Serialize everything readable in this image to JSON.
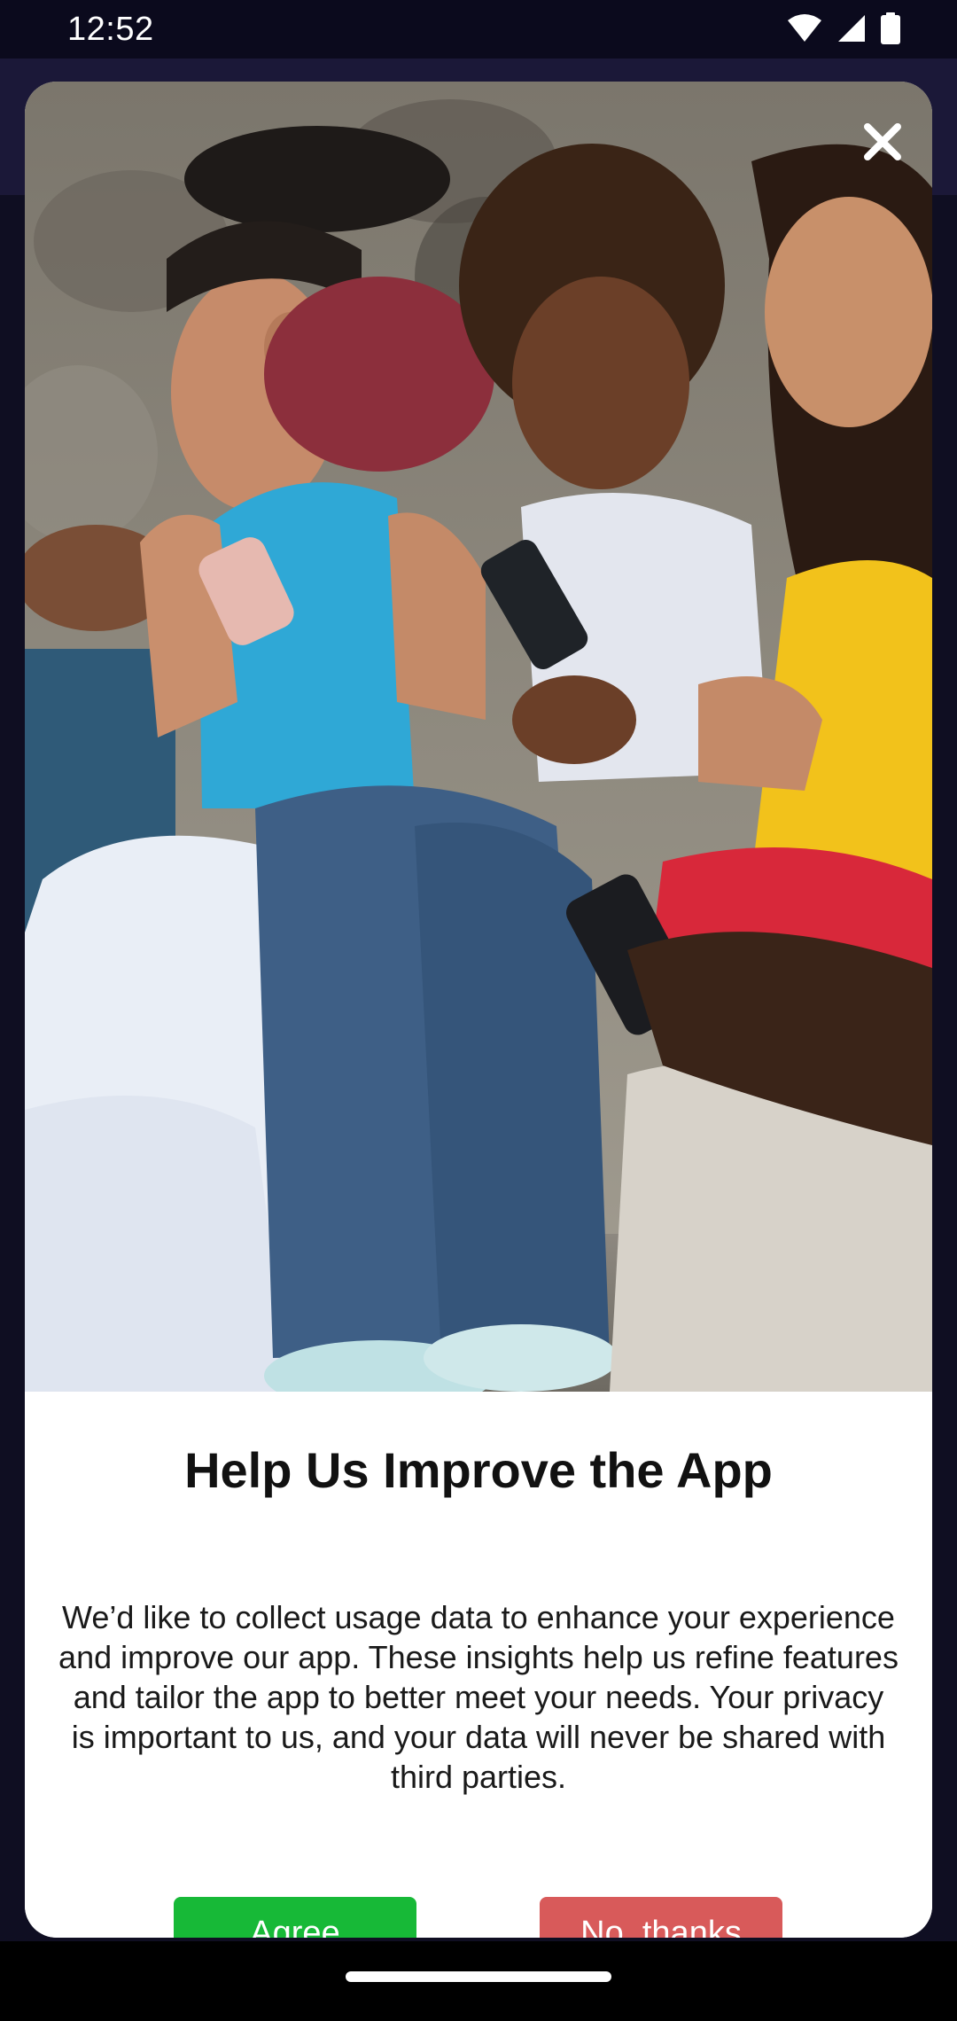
{
  "status_bar": {
    "time": "12:52",
    "icons": [
      "wifi-icon",
      "cellular-signal-icon",
      "battery-icon"
    ]
  },
  "dialog": {
    "hero_image": "people-smiling-using-smartphones-photo",
    "close_icon": "close-icon",
    "title": "Help Us Improve the App",
    "body": "We’d like to collect usage data to enhance your experience and improve our app. These insights help us refine features and tailor the app to better meet your needs. Your privacy is important to us, and your data will never be shared with third parties.",
    "agree_label": "Agree",
    "decline_label": "No, thanks"
  },
  "colors": {
    "agree": "#17b937",
    "decline": "#d85a5a",
    "background": "#0b0a1d",
    "app_bar": "#1b1838"
  }
}
